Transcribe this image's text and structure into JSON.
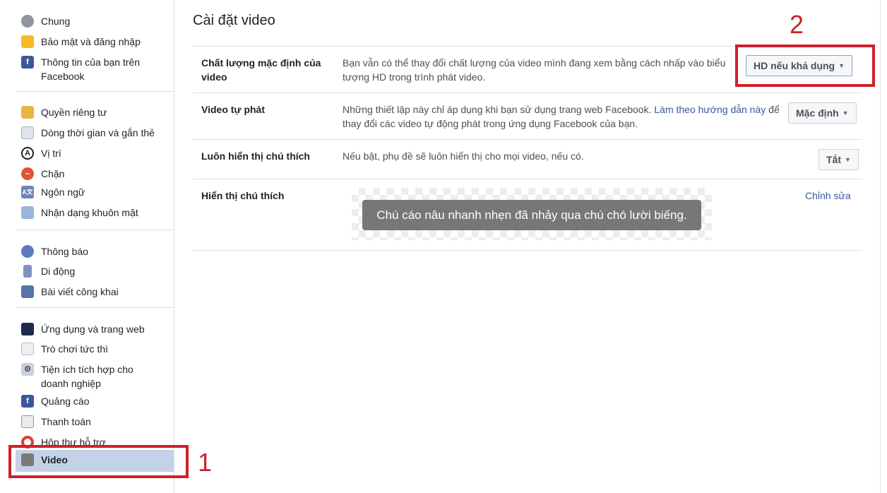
{
  "sidebar": {
    "items": [
      {
        "label": "Chung",
        "icon": "gears-icon"
      },
      {
        "label": "Bảo mật và đăng nhập",
        "icon": "shield-icon"
      },
      {
        "label": "Thông tin của bạn trên Facebook",
        "icon": "facebook-icon"
      },
      {
        "label": "Quyền riêng tư",
        "icon": "lock-icon"
      },
      {
        "label": "Dòng thời gian và gắn thẻ",
        "icon": "timeline-icon"
      },
      {
        "label": "Vị trí",
        "icon": "location-icon"
      },
      {
        "label": "Chặn",
        "icon": "block-icon"
      },
      {
        "label": "Ngôn ngữ",
        "icon": "language-icon"
      },
      {
        "label": "Nhận dạng khuôn mặt",
        "icon": "face-icon"
      },
      {
        "label": "Thông báo",
        "icon": "globe-icon"
      },
      {
        "label": "Di động",
        "icon": "mobile-icon"
      },
      {
        "label": "Bài viết công khai",
        "icon": "rss-icon"
      },
      {
        "label": "Ứng dụng và trang web",
        "icon": "apps-icon"
      },
      {
        "label": "Trò chơi tức thì",
        "icon": "gamepad-icon"
      },
      {
        "label": "Tiện ích tích hợp cho doanh nghiệp",
        "icon": "business-integrations-icon"
      },
      {
        "label": "Quảng cáo",
        "icon": "ads-icon"
      },
      {
        "label": "Thanh toán",
        "icon": "credit-card-icon"
      },
      {
        "label": "Hộp thư hỗ trợ",
        "icon": "lifebuoy-icon"
      },
      {
        "label": "Video",
        "icon": "film-icon",
        "selected": true
      }
    ]
  },
  "main": {
    "title": "Cài đặt video",
    "rows": [
      {
        "label": "Chất lượng mặc định của video",
        "desc": "Bạn vẫn có thể thay đổi chất lượng của video mình đang xem bằng cách nhấp vào biểu tượng HD trong trình phát video.",
        "value": "HD nếu khả dụng"
      },
      {
        "label": "Video tự phát",
        "desc": "Những thiết lập này chỉ áp dụng khi bạn sử dụng trang web Facebook. ",
        "link": "Làm theo hướng dẫn này",
        "desc_after": " để thay đổi các video tự động phát trong ứng dụng Facebook của bạn.",
        "value": "Mặc định"
      },
      {
        "label": "Luôn hiển thị chú thích",
        "desc": "Nếu bật, phụ đề sẽ luôn hiển thị cho mọi video, nếu có.",
        "value": "Tắt"
      },
      {
        "label": "Hiển thị chú thích",
        "caption_preview": "Chú cáo nâu nhanh nhẹn đã nhảy qua chú chó lười biếng.",
        "edit": "Chỉnh sửa"
      }
    ]
  },
  "annotations": {
    "marker1": "1",
    "marker2": "2",
    "color": "#d0202a"
  },
  "colors": {
    "selected_bg": "#c4d2e7",
    "link": "#365899"
  }
}
